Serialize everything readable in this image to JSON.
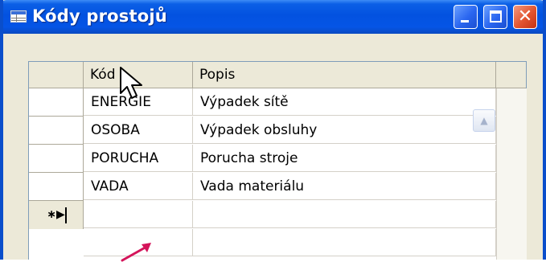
{
  "window": {
    "title": "Kódy prostojů"
  },
  "controls": {
    "minimize": "minimize",
    "maximize": "maximize",
    "close": "✕"
  },
  "table": {
    "columns": [
      "Kód",
      "Popis"
    ],
    "rows": [
      {
        "kod": "ENERGIE",
        "popis": "Výpadek sítě"
      },
      {
        "kod": "OSOBA",
        "popis": "Výpadek obsluhy"
      },
      {
        "kod": "PORUCHA",
        "popis": "Porucha stroje"
      },
      {
        "kod": "VADA",
        "popis": "Vada materiálu"
      }
    ],
    "new_row_indicator": "∗▶"
  },
  "colors": {
    "accent": "#0a4ecb",
    "annotation": "#d4145a"
  }
}
